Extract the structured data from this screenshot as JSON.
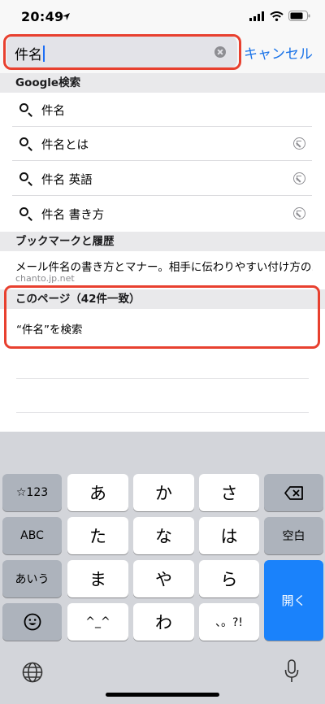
{
  "status_bar": {
    "time": "20:49"
  },
  "search": {
    "query": "件名",
    "cancel_label": "キャンセル"
  },
  "sections": {
    "google": "Google検索",
    "bookmarks": "ブックマークと履歴",
    "on_page": "このページ（42件一致）"
  },
  "suggestions": [
    {
      "label": "件名"
    },
    {
      "label": "件名とは"
    },
    {
      "label": "件名 英語"
    },
    {
      "label": "件名 書き方"
    }
  ],
  "bookmark": {
    "title": "メール件名の書き方とマナー。相手に伝わりやすい付け方の…",
    "url": "chanto.jp.net"
  },
  "find_on_page": {
    "label": "“件名”を検索"
  },
  "keyboard": {
    "row1": [
      "☆123",
      "あ",
      "か",
      "さ"
    ],
    "row2": [
      "ABC",
      "た",
      "な",
      "は",
      "空白"
    ],
    "row3": [
      "あいう",
      "ま",
      "や",
      "ら"
    ],
    "row4": [
      "^_^",
      "わ",
      "、。?!"
    ],
    "return_label": "開く"
  },
  "colors": {
    "accent": "#1a73e8",
    "highlight": "#e8402f",
    "return_key": "#1a82fb"
  }
}
